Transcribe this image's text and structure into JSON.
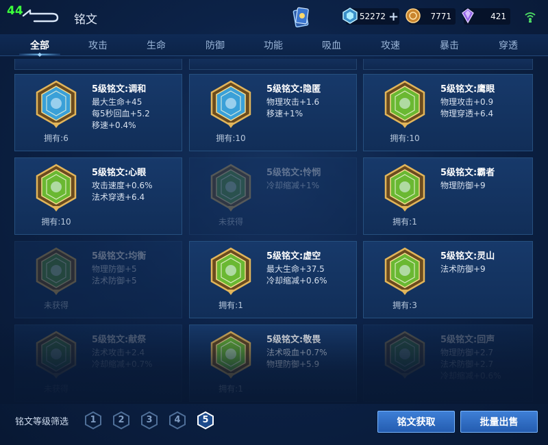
{
  "header": {
    "fps": "44",
    "title": "铭文",
    "currency": [
      {
        "name": "diamond-icon",
        "value": "52272",
        "color": "#7fd9ff"
      },
      {
        "name": "gold-coin-icon",
        "value": "7771",
        "color": "#e0a64a"
      },
      {
        "name": "crystal-icon",
        "value": "421",
        "color": "#b58cff"
      }
    ]
  },
  "tabs": [
    {
      "label": "全部",
      "active": true
    },
    {
      "label": "攻击"
    },
    {
      "label": "生命"
    },
    {
      "label": "防御"
    },
    {
      "label": "功能"
    },
    {
      "label": "吸血"
    },
    {
      "label": "攻速"
    },
    {
      "label": "暴击"
    },
    {
      "label": "穿透"
    }
  ],
  "cards": [
    {
      "title": "5级铭文:调和",
      "stats": [
        "最大生命+45",
        "每5秒回血+5.2",
        "移速+0.4%"
      ],
      "owned": "拥有:6",
      "gem_color": "#3aa0d8",
      "locked": false
    },
    {
      "title": "5级铭文:隐匿",
      "stats": [
        "物理攻击+1.6",
        "移速+1%"
      ],
      "owned": "拥有:10",
      "gem_color": "#3aa0d8",
      "locked": false
    },
    {
      "title": "5级铭文:鹰眼",
      "stats": [
        "物理攻击+0.9",
        "物理穿透+6.4"
      ],
      "owned": "拥有:10",
      "gem_color": "#6ab832",
      "locked": false
    },
    {
      "title": "5级铭文:心眼",
      "stats": [
        "攻击速度+0.6%",
        "法术穿透+6.4"
      ],
      "owned": "拥有:10",
      "gem_color": "#6ab832",
      "locked": false
    },
    {
      "title": "5级铭文:怜悯",
      "stats": [
        "冷却缩减+1%"
      ],
      "owned": "未获得",
      "gem_color": "#5b9a3a",
      "locked": true
    },
    {
      "title": "5级铭文:霸者",
      "stats": [
        "物理防御+9"
      ],
      "owned": "拥有:1",
      "gem_color": "#6ab832",
      "locked": false
    },
    {
      "title": "5级铭文:均衡",
      "stats": [
        "物理防御+5",
        "法术防御+5"
      ],
      "owned": "未获得",
      "gem_color": "#5b9a3a",
      "locked": true
    },
    {
      "title": "5级铭文:虚空",
      "stats": [
        "最大生命+37.5",
        "冷却缩减+0.6%"
      ],
      "owned": "拥有:1",
      "gem_color": "#6ab832",
      "locked": false
    },
    {
      "title": "5级铭文:灵山",
      "stats": [
        "法术防御+9"
      ],
      "owned": "拥有:3",
      "gem_color": "#6ab832",
      "locked": false
    },
    {
      "title": "5级铭文:献祭",
      "stats": [
        "法术攻击+2.4",
        "冷却缩减+0.7%"
      ],
      "owned": "未获得",
      "gem_color": "#5b9a3a",
      "locked": true
    },
    {
      "title": "5级铭文:敬畏",
      "stats": [
        "法术吸血+0.7%",
        "物理防御+5.9"
      ],
      "owned": "拥有:1",
      "gem_color": "#6ab832",
      "locked": false
    },
    {
      "title": "5级铭文:回声",
      "stats": [
        "物理防御+2.7",
        "法术防御+2.7",
        "冷却缩减+0.6%"
      ],
      "owned": "",
      "gem_color": "#5b9a3a",
      "locked": true
    }
  ],
  "footer": {
    "filter_label": "铭文等级筛选",
    "levels": [
      {
        "label": "1",
        "active": false
      },
      {
        "label": "2",
        "active": false
      },
      {
        "label": "3",
        "active": false
      },
      {
        "label": "4",
        "active": false
      },
      {
        "label": "5",
        "active": true
      }
    ],
    "acquire_label": "铭文获取",
    "sell_label": "批量出售"
  }
}
